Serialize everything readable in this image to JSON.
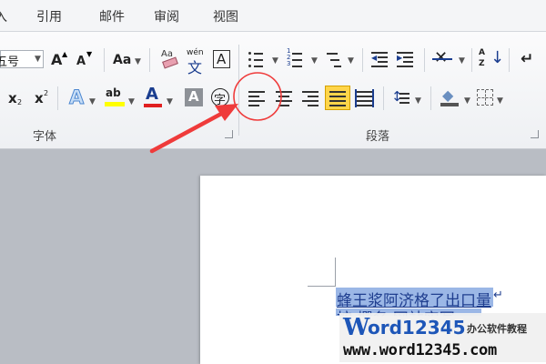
{
  "menu": {
    "items": [
      "插入",
      "引用",
      "邮件",
      "审阅",
      "视图"
    ]
  },
  "ribbon": {
    "font_group_label": "字体",
    "paragraph_group_label": "段落",
    "font_size_value": "五号",
    "aa_label": "Aa",
    "wen_label": "wén",
    "char_border_label": "A",
    "circle_char_label": "字",
    "subscript_label": "x",
    "subscript_mark": "2",
    "superscript_label": "x",
    "superscript_mark": "2",
    "grow_font_label": "A",
    "shrink_font_label": "A",
    "text_effect_label": "A",
    "highlight_label": "ab",
    "font_color_label": "A",
    "char_shading_label": "A",
    "sort_label": "A Z"
  },
  "document": {
    "line1": "蜂王浆阿济格了出口量",
    "line2": "按   撰名  网站实写",
    "para_mark": "↵"
  },
  "watermark": {
    "logo_w": "W",
    "logo_rest": "ord12345",
    "tagline": "办公软件教程",
    "url": "www.word12345.com"
  },
  "colors": {
    "highlight": "#ffff00",
    "font_color": "#e02020",
    "selection": "#9bb7e6",
    "annotation": "#ef3b3b",
    "logo_blue": "#1d56b8",
    "logo_red": "#e8331f"
  }
}
